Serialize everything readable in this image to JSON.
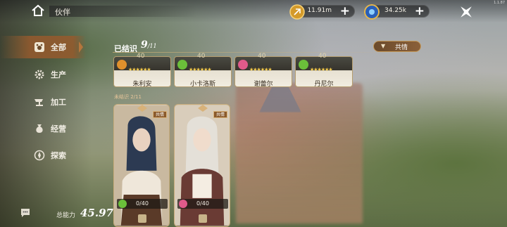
{
  "header": {
    "title": "伙伴",
    "resource_gold": "11.91m",
    "resource_gem": "34.25k",
    "version": "1.1.87"
  },
  "sidebar": {
    "items": [
      {
        "label": "全部",
        "icon": "paw-icon",
        "active": true
      },
      {
        "label": "生产",
        "icon": "gear-icon",
        "active": false
      },
      {
        "label": "加工",
        "icon": "anvil-icon",
        "active": false
      },
      {
        "label": "经营",
        "icon": "pouch-icon",
        "active": false
      },
      {
        "label": "探索",
        "icon": "compass-icon",
        "active": false
      }
    ]
  },
  "power": {
    "label": "总能力",
    "value": "45.97w"
  },
  "bonded": {
    "label": "已结识",
    "count": "9",
    "total": "/11",
    "filter_label": "共情",
    "partners": [
      {
        "name": "朱利安",
        "level": "40",
        "stars": "★★★★★★",
        "element_color": "#e0902c"
      },
      {
        "name": "小卡洛斯",
        "level": "40",
        "stars": "★★★★★★",
        "element_color": "#6bbf3a"
      },
      {
        "name": "谢蕾尔",
        "level": "40",
        "stars": "★★★★★★",
        "element_color": "#e05a8a"
      },
      {
        "name": "丹尼尔",
        "level": "40",
        "stars": "★★★★★★",
        "element_color": "#6bbf3a"
      }
    ]
  },
  "unbonded": {
    "label": "未结识 2/11",
    "cards": [
      {
        "fragments": "0/40",
        "badge": "共情",
        "element_color": "#6bbf3a"
      },
      {
        "fragments": "0/40",
        "badge": "共情",
        "element_color": "#e05a8a"
      }
    ]
  },
  "colors": {
    "accent": "#8a603a",
    "star": "#f2c94c"
  }
}
